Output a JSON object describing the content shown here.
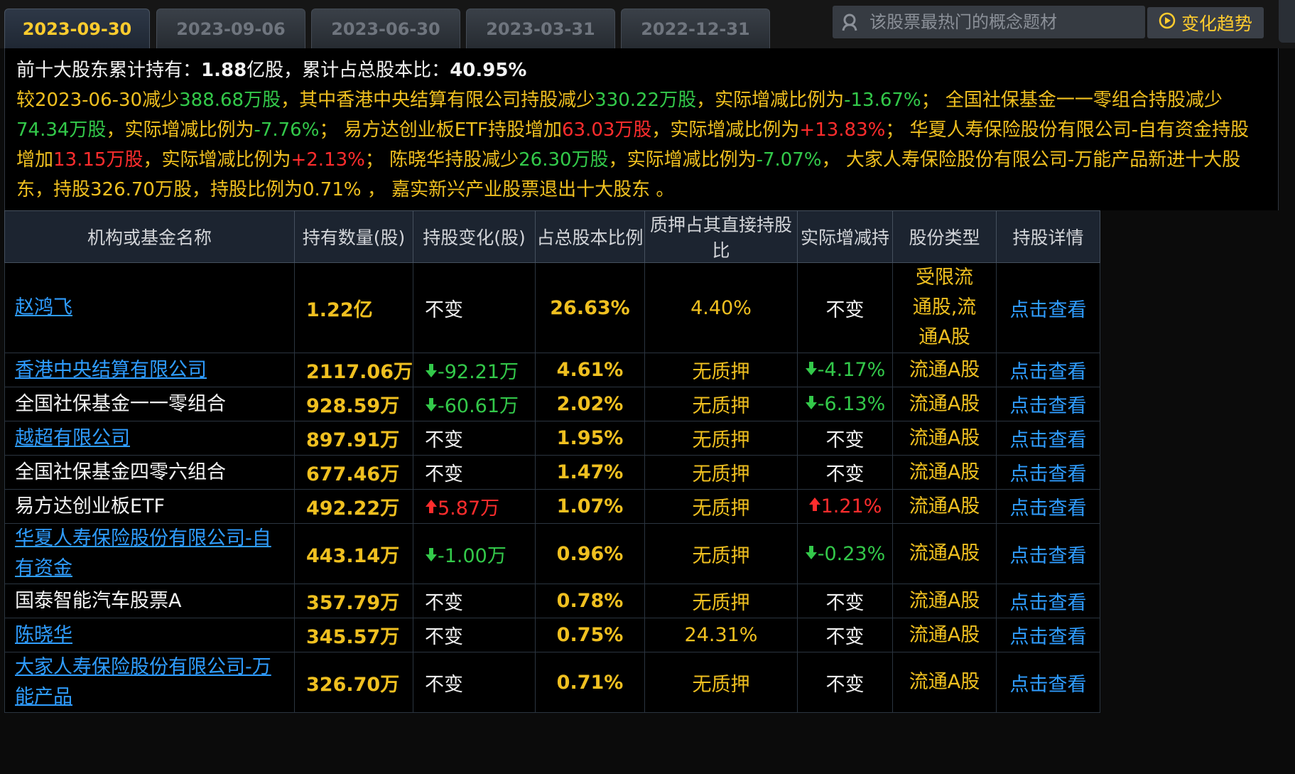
{
  "tabs": [
    {
      "label": "2023-09-30",
      "active": true
    },
    {
      "label": "2023-09-06",
      "active": false
    },
    {
      "label": "2023-06-30",
      "active": false
    },
    {
      "label": "2023-03-31",
      "active": false
    },
    {
      "label": "2022-12-31",
      "active": false
    }
  ],
  "search": {
    "placeholder": "该股票最热门的概念题材"
  },
  "trend_button": {
    "label": "变化趋势"
  },
  "summary": {
    "line1_prefix": "前十大股东累计持有：",
    "line1_value": "1.88",
    "line1_mid": "亿股，累计占总股本比：",
    "line1_pct": "40.95%",
    "p1": "较2023-06-30减少",
    "p2": "388.68万股",
    "p3": "，其中香港中央结算有限公司持股减少",
    "p4": "330.22万股",
    "p5": "，实际增减比例为",
    "p6": "-13.67%",
    "p7": "；  全国社保基金一一零组合持股减少",
    "p8": "74.34万股",
    "p9": "，实际增减比例为",
    "p10": "-7.76%",
    "p11": "；  易方达创业板ETF持股增加",
    "p12": "63.03万股",
    "p13": "，实际增减比例为",
    "p14": "+13.83%",
    "p15": "；  华夏人寿保险股份有限公司-自有资金持股增加",
    "p16": "13.15万股",
    "p17": "，实际增减比例为",
    "p18": "+2.13%",
    "p19": "；  陈晓华持股减少",
    "p20": "26.30万股",
    "p21": "，实际增减比例为",
    "p22": "-7.07%",
    "p23": "，  大家人寿保险股份有限公司-万能产品新进十大股东，持股326.70万股，持股比例为0.71%  ，  嘉实新兴产业股票退出十大股东  。"
  },
  "table": {
    "headers": [
      "机构或基金名称",
      "持有数量(股)",
      "持股变化(股)",
      "占总股本比例",
      "质押占其直接持股比",
      "实际增减持",
      "股份类型",
      "持股详情"
    ],
    "rows": [
      {
        "name": "赵鸿飞",
        "link": true,
        "qty": "1.22亿",
        "change": "不变",
        "change_dir": "none",
        "ratio": "26.63%",
        "pledge": "4.40%",
        "actual": "不变",
        "actual_dir": "none",
        "type": "受限流通股,流通A股",
        "detail": "点击查看"
      },
      {
        "name": "香港中央结算有限公司",
        "link": true,
        "qty": "2117.06万",
        "change": "-92.21万",
        "change_dir": "down",
        "ratio": "4.61%",
        "pledge": "无质押",
        "actual": "-4.17%",
        "actual_dir": "down",
        "type": "流通A股",
        "detail": "点击查看"
      },
      {
        "name": "全国社保基金一一零组合",
        "link": false,
        "qty": "928.59万",
        "change": "-60.61万",
        "change_dir": "down",
        "ratio": "2.02%",
        "pledge": "无质押",
        "actual": "-6.13%",
        "actual_dir": "down",
        "type": "流通A股",
        "detail": "点击查看"
      },
      {
        "name": "越超有限公司",
        "link": true,
        "qty": "897.91万",
        "change": "不变",
        "change_dir": "none",
        "ratio": "1.95%",
        "pledge": "无质押",
        "actual": "不变",
        "actual_dir": "none",
        "type": "流通A股",
        "detail": "点击查看"
      },
      {
        "name": "全国社保基金四零六组合",
        "link": false,
        "qty": "677.46万",
        "change": "不变",
        "change_dir": "none",
        "ratio": "1.47%",
        "pledge": "无质押",
        "actual": "不变",
        "actual_dir": "none",
        "type": "流通A股",
        "detail": "点击查看"
      },
      {
        "name": "易方达创业板ETF",
        "link": false,
        "qty": "492.22万",
        "change": "5.87万",
        "change_dir": "up",
        "ratio": "1.07%",
        "pledge": "无质押",
        "actual": "1.21%",
        "actual_dir": "up",
        "type": "流通A股",
        "detail": "点击查看"
      },
      {
        "name": "华夏人寿保险股份有限公司-自有资金",
        "link": true,
        "qty": "443.14万",
        "change": "-1.00万",
        "change_dir": "down",
        "ratio": "0.96%",
        "pledge": "无质押",
        "actual": "-0.23%",
        "actual_dir": "down",
        "type": "流通A股",
        "detail": "点击查看"
      },
      {
        "name": "国泰智能汽车股票A",
        "link": false,
        "qty": "357.79万",
        "change": "不变",
        "change_dir": "none",
        "ratio": "0.78%",
        "pledge": "无质押",
        "actual": "不变",
        "actual_dir": "none",
        "type": "流通A股",
        "detail": "点击查看"
      },
      {
        "name": "陈晓华",
        "link": true,
        "qty": "345.57万",
        "change": "不变",
        "change_dir": "none",
        "ratio": "0.75%",
        "pledge": "24.31%",
        "actual": "不变",
        "actual_dir": "none",
        "type": "流通A股",
        "detail": "点击查看"
      },
      {
        "name": "大家人寿保险股份有限公司-万能产品",
        "link": true,
        "qty": "326.70万",
        "change": "不变",
        "change_dir": "none",
        "ratio": "0.71%",
        "pledge": "无质押",
        "actual": "不变",
        "actual_dir": "none",
        "type": "流通A股",
        "detail": "点击查看"
      }
    ]
  },
  "colors": {
    "accent": "#f0c020",
    "down": "#33c94a",
    "up": "#ff2d2d",
    "link": "#2f9dff"
  }
}
